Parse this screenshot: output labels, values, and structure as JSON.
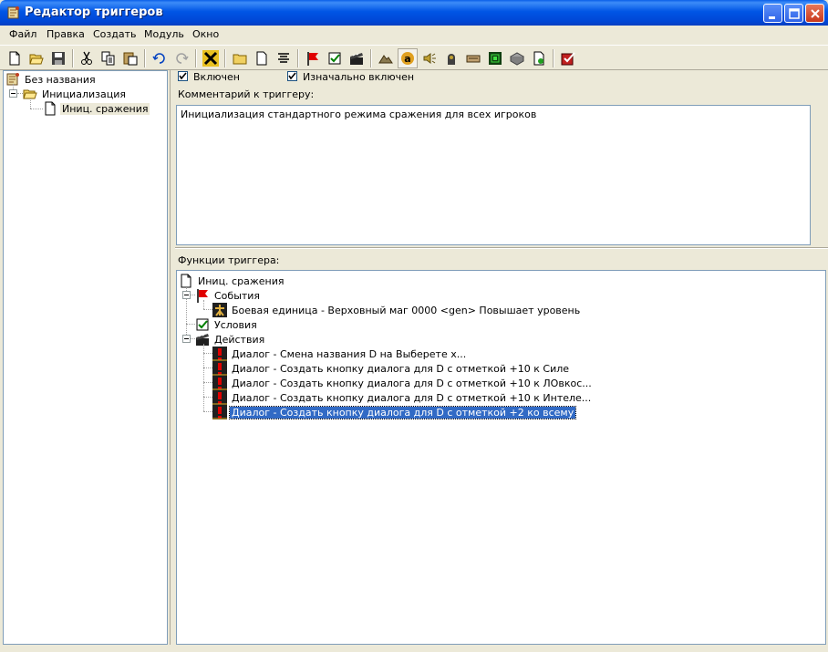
{
  "window": {
    "title": "Редактор триггеров",
    "app_icon": "scroll-icon"
  },
  "menu": [
    "Файл",
    "Правка",
    "Создать",
    "Модуль",
    "Окно"
  ],
  "toolbar": {
    "buttons": [
      "new-icon",
      "open-icon",
      "save-icon",
      "cut-icon",
      "copy-icon",
      "paste-icon",
      "undo-icon",
      "redo-icon",
      "delete-x-icon",
      "new-category-icon",
      "new-trigger-icon",
      "new-comment-icon",
      "new-event-icon",
      "new-condition-icon",
      "new-action-icon",
      "terrain-editor-icon",
      "trigger-editor-icon",
      "sound-editor-icon",
      "object-editor-icon",
      "camp-editor-icon",
      "ai-editor-icon",
      "import-manager-icon",
      "script-icon",
      "test-map-icon"
    ]
  },
  "tree": {
    "root": "Без названия",
    "category": "Инициализация",
    "trigger": "Иниц. сражения"
  },
  "options": {
    "enabled_label": "Включен",
    "enabled": true,
    "initially_on_label": "Изначально включен",
    "initially_on": true
  },
  "comment": {
    "label": "Комментарий к триггеру:",
    "text": "Инициализация стандартного режима сражения для всех игроков"
  },
  "functions": {
    "label": "Функции триггера:",
    "trigger_name": "Иниц. сражения",
    "events_label": "События",
    "event_item": "Боевая единица - Верховный маг 0000 <gen> Повышает уровень",
    "conditions_label": "Условия",
    "actions_label": "Действия",
    "actions": [
      "Диалог - Смена названия D на Выберете х...",
      "Диалог - Создать кнопку диалога для D с отметкой +10 к Силе",
      "Диалог - Создать кнопку диалога для D с отметкой +10 к ЛОвкос...",
      "Диалог - Создать кнопку диалога для D с отметкой +10 к Интеле...",
      "Диалог - Создать кнопку диалога для D с отметкой +2 ко всему"
    ],
    "selected_action": 4
  },
  "colors": {
    "titlebar": "#0055E5",
    "selection": "#316AC5",
    "face": "#ECE9D8"
  }
}
